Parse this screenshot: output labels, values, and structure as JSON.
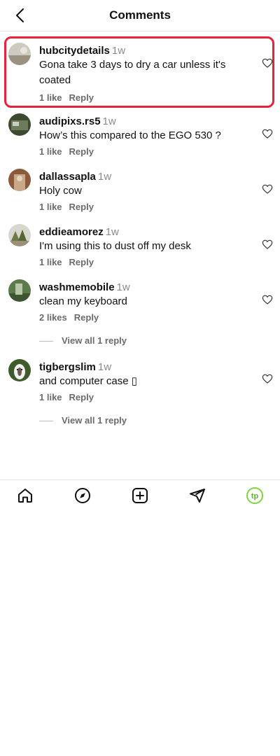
{
  "header": {
    "title": "Comments"
  },
  "comments": [
    {
      "user": "hubcitydetails",
      "time": "1w",
      "text": "Gona take 3 days to dry a car unless it's coated",
      "likes": "1 like",
      "reply": "Reply",
      "view_replies": ""
    },
    {
      "user": "audipixs.rs5",
      "time": "1w",
      "text": "How’s this compared to the EGO 530 ?",
      "likes": "1 like",
      "reply": "Reply",
      "view_replies": ""
    },
    {
      "user": "dallassapla",
      "time": "1w",
      "text": "Holy cow",
      "likes": "1 like",
      "reply": "Reply",
      "view_replies": ""
    },
    {
      "user": "eddieamorez",
      "time": "1w",
      "text": "I'm using this to dust off my desk",
      "likes": "1 like",
      "reply": "Reply",
      "view_replies": ""
    },
    {
      "user": "washmemobile",
      "time": "1w",
      "text": "clean my keyboard",
      "likes": "2 likes",
      "reply": "Reply",
      "view_replies": "View all 1 reply"
    },
    {
      "user": "tigbergslim",
      "time": "1w",
      "text": "and computer case ▯",
      "likes": "1 like",
      "reply": "Reply",
      "view_replies": "View all 1 reply"
    }
  ],
  "nav": {
    "items": [
      "home-icon",
      "explore-compass-icon",
      "create-plus-icon",
      "direct-send-icon",
      "profile-avatar-icon"
    ],
    "accent": "#7bd63b"
  },
  "colors": {
    "highlight": "#e6233b"
  }
}
